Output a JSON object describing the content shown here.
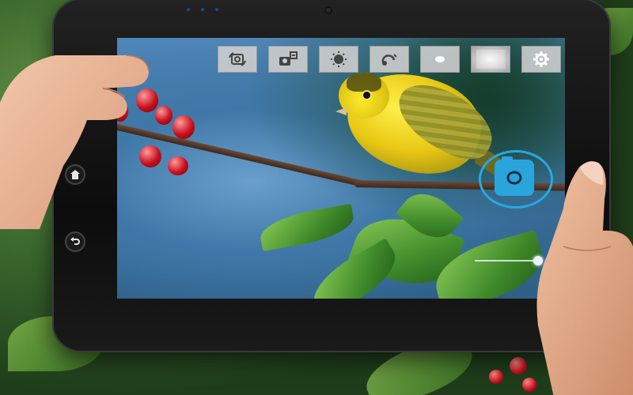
{
  "scene": {
    "device": "tablet",
    "subject": "camera-app-viewfinder"
  },
  "device_buttons": {
    "home_icon": "home-icon",
    "back_icon": "back-icon"
  },
  "camera_app": {
    "toolbar": [
      {
        "icon": "switch-camera-icon"
      },
      {
        "icon": "camera-settings-icon"
      },
      {
        "icon": "brightness-icon"
      },
      {
        "icon": "timer-icon"
      },
      {
        "icon": "flash-dot-icon"
      },
      {
        "icon": "gallery-thumbnail-icon"
      },
      {
        "icon": "gear-icon"
      }
    ],
    "shutter_icon": "camera-shutter-icon",
    "zoom_level": 1.0
  },
  "colors": {
    "accent": "#2aa5dc",
    "toolbar_bg": "#cdcdcd"
  }
}
